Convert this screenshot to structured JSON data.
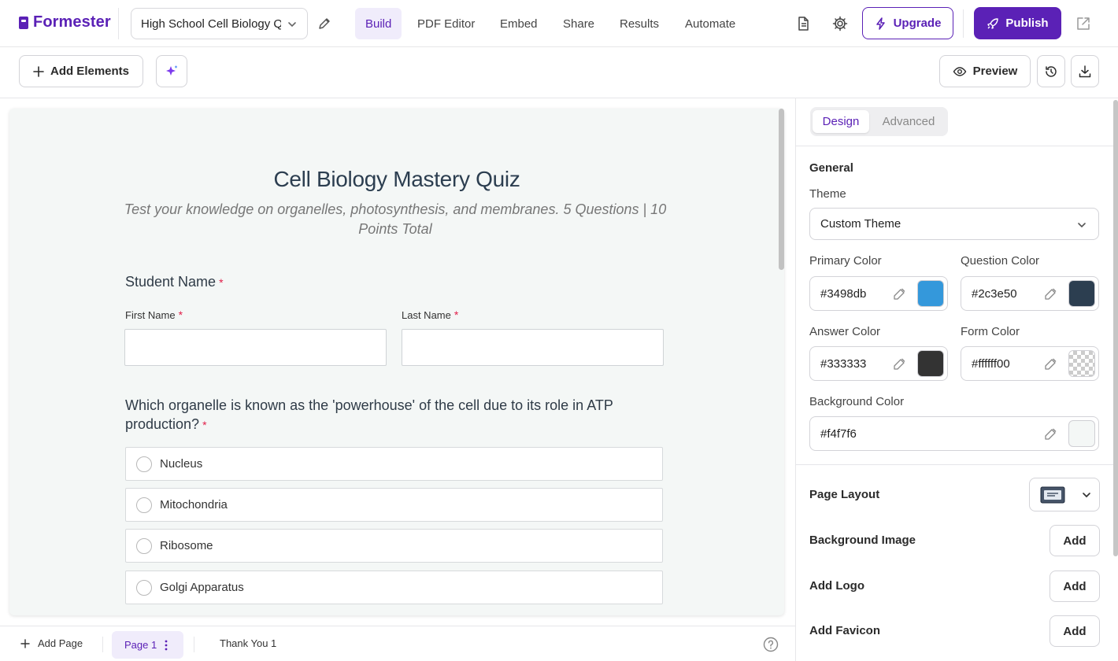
{
  "app": {
    "name": "Formester"
  },
  "form_selector": {
    "value": "High School Cell Biology Quiz"
  },
  "nav": {
    "items": [
      {
        "label": "Build",
        "active": true
      },
      {
        "label": "PDF Editor",
        "active": false
      },
      {
        "label": "Embed",
        "active": false
      },
      {
        "label": "Share",
        "active": false
      },
      {
        "label": "Results",
        "active": false
      },
      {
        "label": "Automate",
        "active": false
      }
    ]
  },
  "header": {
    "upgrade_label": "Upgrade",
    "publish_label": "Publish"
  },
  "toolbar": {
    "add_elements_label": "Add Elements",
    "preview_label": "Preview"
  },
  "form": {
    "title": "Cell Biology Mastery Quiz",
    "description": "Test your knowledge on organelles, photosynthesis, and membranes. 5 Questions | 10 Points Total",
    "student_name": {
      "label": "Student Name",
      "first_name_label": "First Name",
      "last_name_label": "Last Name"
    },
    "question1": {
      "text": "Which organelle is known as the 'powerhouse' of the cell due to its role in ATP production?",
      "options": [
        "Nucleus",
        "Mitochondria",
        "Ribosome",
        "Golgi Apparatus"
      ]
    },
    "required_marker": "*"
  },
  "pages": {
    "add_label": "Add Page",
    "current": "Page 1",
    "thank_you": "Thank You 1"
  },
  "panel": {
    "tabs": [
      {
        "label": "Design",
        "active": true
      },
      {
        "label": "Advanced",
        "active": false
      }
    ],
    "general_heading": "General",
    "theme_label": "Theme",
    "theme_value": "Custom Theme",
    "primary_color": {
      "label": "Primary Color",
      "value": "#3498db",
      "swatch": "#3498db"
    },
    "question_color": {
      "label": "Question Color",
      "value": "#2c3e50",
      "swatch": "#2c3e50"
    },
    "answer_color": {
      "label": "Answer Color",
      "value": "#333333",
      "swatch": "#333333"
    },
    "form_color": {
      "label": "Form Color",
      "value": "#ffffff00",
      "swatch": "transparent"
    },
    "background_color": {
      "label": "Background Color",
      "value": "#f4f7f6",
      "swatch": "#f4f7f6"
    },
    "page_layout_label": "Page Layout",
    "background_image_label": "Background Image",
    "add_logo_label": "Add Logo",
    "add_favicon_label": "Add Favicon",
    "add_button_label": "Add"
  },
  "colors": {
    "brand": "#5b21b6",
    "required": "#e11d48"
  }
}
